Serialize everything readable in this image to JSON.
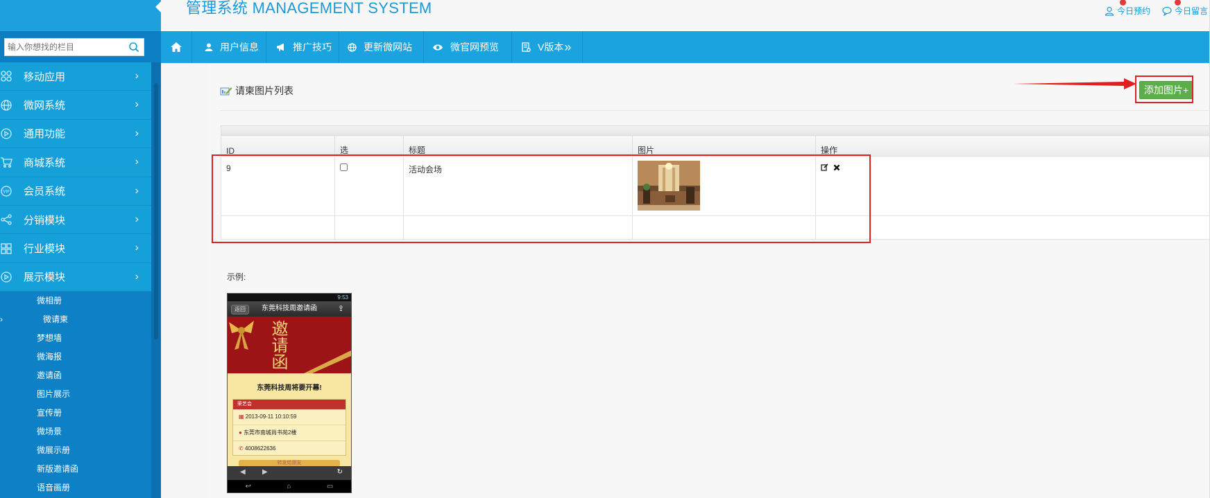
{
  "header": {
    "title": "管理系统 MANAGEMENT SYSTEM",
    "links": [
      {
        "label": "今日预约",
        "icon": "user-icon"
      },
      {
        "label": "今日留言",
        "icon": "chat-icon"
      }
    ]
  },
  "sidebar": {
    "search_placeholder": "输入你想找的栏目",
    "menu": [
      {
        "label": "移动应用",
        "icon": "apps-icon"
      },
      {
        "label": "微网系统",
        "icon": "globe-icon"
      },
      {
        "label": "通用功能",
        "icon": "play-circle-icon"
      },
      {
        "label": "商城系统",
        "icon": "cart-icon"
      },
      {
        "label": "会员系统",
        "icon": "vip-icon"
      },
      {
        "label": "分销模块",
        "icon": "share-icon"
      },
      {
        "label": "行业模块",
        "icon": "grid-icon"
      },
      {
        "label": "展示模块",
        "icon": "play-circle-icon"
      }
    ],
    "submenu": [
      {
        "label": "微相册"
      },
      {
        "label": "微请柬",
        "active": true
      },
      {
        "label": "梦想墙"
      },
      {
        "label": "微海报"
      },
      {
        "label": "邀请函"
      },
      {
        "label": "图片展示"
      },
      {
        "label": "宣传册"
      },
      {
        "label": "微场景"
      },
      {
        "label": "微展示册"
      },
      {
        "label": "新版邀请函"
      },
      {
        "label": "语音画册"
      }
    ]
  },
  "navbar": {
    "items": [
      {
        "label": "",
        "icon": "home-icon"
      },
      {
        "label": "用户信息",
        "icon": "user-icon"
      },
      {
        "label": "推广技巧",
        "icon": "megaphone-icon"
      },
      {
        "label": "更新微网站",
        "icon": "globe-icon"
      },
      {
        "label": "微官网预览",
        "icon": "eye-icon"
      },
      {
        "label": "V版本",
        "icon": "document-icon"
      }
    ],
    "more_glyph": "»"
  },
  "main": {
    "panel_title": "请柬图片列表",
    "add_button_label": "添加图片+",
    "table": {
      "columns": [
        "ID",
        "选",
        "标题",
        "图片",
        "操作"
      ],
      "rows": [
        {
          "id": "9",
          "title": "活动会场",
          "image": "hotel-lobby-thumbnail",
          "checked": false
        }
      ]
    },
    "example_label": "示例:",
    "example_phone": {
      "status_time": "9:53",
      "back_label": "返回",
      "title": "东莞科技周邀请函",
      "calligraphy": "邀请函",
      "headline": "东莞科技周将要开幕!",
      "card_header": "荣艺会",
      "datetime": "2013-09-11 10:10:59",
      "address": "东莞市南城尚书苑2楼",
      "phone": "4008622636",
      "share_label": "转发给朋友"
    }
  },
  "colors": {
    "sidebar_bg": "#15a0da",
    "sidebar_dark": "#0c7ec4",
    "nav_bg": "#1aa3df",
    "title_color": "#1a9ad6",
    "add_button": "#5cae4a",
    "annotation_red": "#e02020"
  }
}
